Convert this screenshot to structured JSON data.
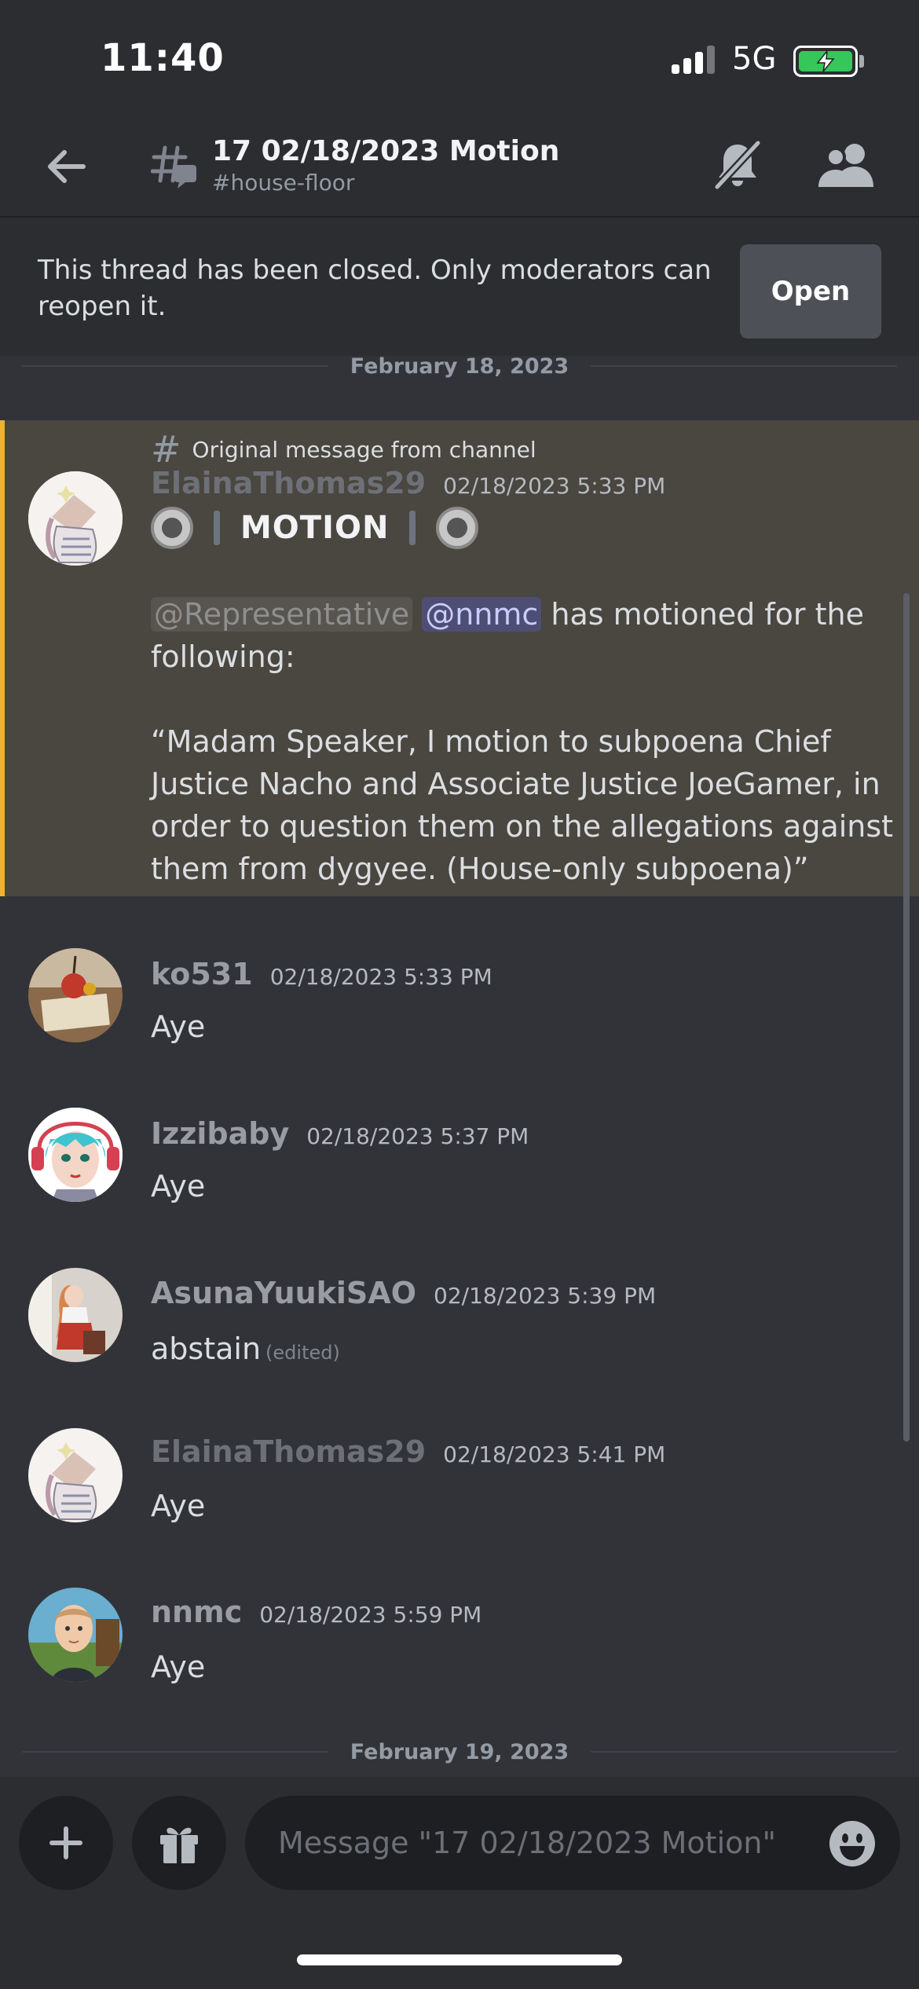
{
  "status_bar": {
    "time": "11:40",
    "network": "5G"
  },
  "header": {
    "title": "17 02/18/2023 Motion",
    "channel": "#house-floor"
  },
  "banner": {
    "text": "This thread has been closed. Only moderators can reopen it.",
    "button": "Open"
  },
  "dividers": [
    "February 18, 2023",
    "February 19, 2023"
  ],
  "original_message": {
    "note": "Original message from channel",
    "username": "ElainaThomas29",
    "timestamp": "02/18/2023 5:33 PM",
    "motion_label": "MOTION",
    "mention_role": "@Representative",
    "mention_user": "@nnmc",
    "line1_rest": " has motioned for the",
    "line2": "following:",
    "quote": "“Madam Speaker, I motion to subpoena Chief Justice Nacho and Associate Justice JoeGamer, in order to question them on the allegations against them from dygyee. (House-only subpoena)”"
  },
  "messages": [
    {
      "username": "ko531",
      "timestamp": "02/18/2023 5:33 PM",
      "text": "Aye",
      "edited": "",
      "name_color": "#9a9ca3"
    },
    {
      "username": "Izzibaby",
      "timestamp": "02/18/2023 5:37 PM",
      "text": "Aye",
      "edited": "",
      "name_color": "#9a9ca3"
    },
    {
      "username": "AsunaYuukiSAO",
      "timestamp": "02/18/2023 5:39 PM",
      "text": "abstain",
      "edited": "(edited)",
      "name_color": "#9a9ca3"
    },
    {
      "username": "ElainaThomas29",
      "timestamp": "02/18/2023 5:41 PM",
      "text": "Aye",
      "edited": "",
      "name_color": "#6e7077"
    },
    {
      "username": "nnmc",
      "timestamp": "02/18/2023 5:59 PM",
      "text": "Aye",
      "edited": "",
      "name_color": "#9a9ca3"
    }
  ],
  "composer": {
    "placeholder": "Message \"17 02/18/2023 Motion\""
  }
}
